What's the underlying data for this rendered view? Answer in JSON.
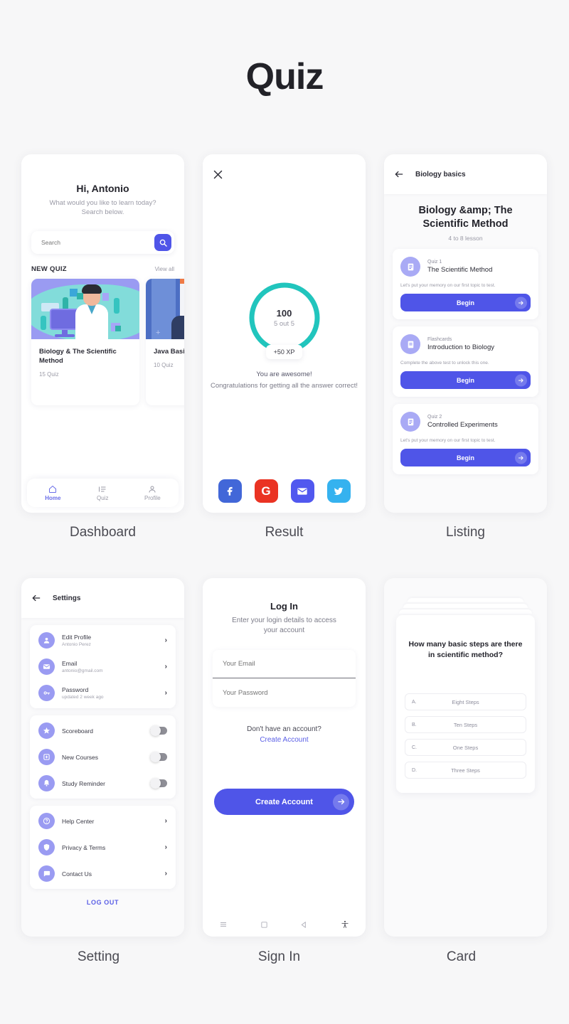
{
  "page": {
    "title": "Quiz"
  },
  "screens": [
    {
      "caption": "Dashboard"
    },
    {
      "caption": "Result"
    },
    {
      "caption": "Listing"
    },
    {
      "caption": "Setting"
    },
    {
      "caption": "Sign In"
    },
    {
      "caption": "Card"
    }
  ],
  "dashboard": {
    "greeting": "Hi, Antonio",
    "subtitle": "What would you like to learn today? Search below.",
    "search_placeholder": "Search",
    "search_icon": "search-icon",
    "section_title": "NEW QUIZ",
    "view_all": "View all",
    "quizzes": [
      {
        "title": "Biology & The Scientific Method",
        "count": "15 Quiz"
      },
      {
        "title": "Java Basic OOPs",
        "count": "10 Quiz"
      }
    ],
    "nav": [
      {
        "label": "Home",
        "icon": "home-icon",
        "active": true
      },
      {
        "label": "Quiz",
        "icon": "list-icon",
        "active": false
      },
      {
        "label": "Profile",
        "icon": "person-icon",
        "active": false
      }
    ]
  },
  "result": {
    "close_icon": "close-icon",
    "score": "100",
    "score_sub": "5 out 5",
    "xp_badge": "+50 XP",
    "headline": "You are awesome!",
    "message": "Congratulations for getting all the answer correct!",
    "ring_color": "#21c5bd",
    "socials": [
      {
        "name": "facebook-icon",
        "glyph": "f",
        "color": "#4267d8"
      },
      {
        "name": "google-icon",
        "glyph": "G",
        "color": "#ea3323"
      },
      {
        "name": "email-icon",
        "glyph": "✉",
        "color": "#5158ef"
      },
      {
        "name": "twitter-icon",
        "glyph": "🐦",
        "color": "#35b2ef"
      }
    ]
  },
  "listing": {
    "back_icon": "back-arrow-icon",
    "appbar_title": "Biology basics",
    "title": "Biology &amp; The Scientific Method",
    "subtitle": "4 to 8 lesson",
    "items": [
      {
        "kind": "Quiz 1",
        "name": "The Scientific Method",
        "desc": "Let's put your memory on our first topic to test.",
        "button": "Begin"
      },
      {
        "kind": "Flashcards",
        "name": "Introduction to Biology",
        "desc": "Complete the above test to unlock this one.",
        "button": "Begin"
      },
      {
        "kind": "Quiz 2",
        "name": "Controlled Experiments",
        "desc": "Let's put your memory on our first topic to test.",
        "button": "Begin"
      }
    ]
  },
  "setting": {
    "back_icon": "back-arrow-icon",
    "appbar_title": "Settings",
    "group_account": [
      {
        "icon": "person-icon",
        "title": "Edit Profile",
        "sub": "Antonio Perez"
      },
      {
        "icon": "envelope-icon",
        "title": "Email",
        "sub": "antonio@gmail.com"
      },
      {
        "icon": "key-icon",
        "title": "Password",
        "sub": "updated 2 week ago"
      }
    ],
    "group_toggles": [
      {
        "icon": "star-icon",
        "title": "Scoreboard",
        "on": false
      },
      {
        "icon": "plus-square-icon",
        "title": "New Courses",
        "on": false
      },
      {
        "icon": "bell-icon",
        "title": "Study Reminder",
        "on": false
      }
    ],
    "group_support": [
      {
        "icon": "question-icon",
        "title": "Help Center"
      },
      {
        "icon": "shield-icon",
        "title": "Privacy & Terms"
      },
      {
        "icon": "chat-icon",
        "title": "Contact Us"
      }
    ],
    "logout": "LOG OUT"
  },
  "signin": {
    "title": "Log In",
    "subtitle": "Enter your login details to access your account",
    "email_placeholder": "Your Email",
    "password_placeholder": "Your Password",
    "no_account": "Don't have an account?",
    "create_account_link": "Create Account",
    "cta": "Create Account",
    "sysnav": [
      "menu-icon",
      "square-icon",
      "back-triangle-icon",
      "accessibility-icon"
    ]
  },
  "card": {
    "question": "How many basic steps are there in scientific method?",
    "options": [
      {
        "letter": "A.",
        "value": "Eight Steps"
      },
      {
        "letter": "B.",
        "value": "Ten Steps"
      },
      {
        "letter": "C.",
        "value": "One Steps"
      },
      {
        "letter": "D.",
        "value": "Three Steps"
      }
    ]
  },
  "theme": {
    "primary": "#4f55e8",
    "accent_teal": "#21c5bd",
    "bg": "#f7f7f8"
  }
}
